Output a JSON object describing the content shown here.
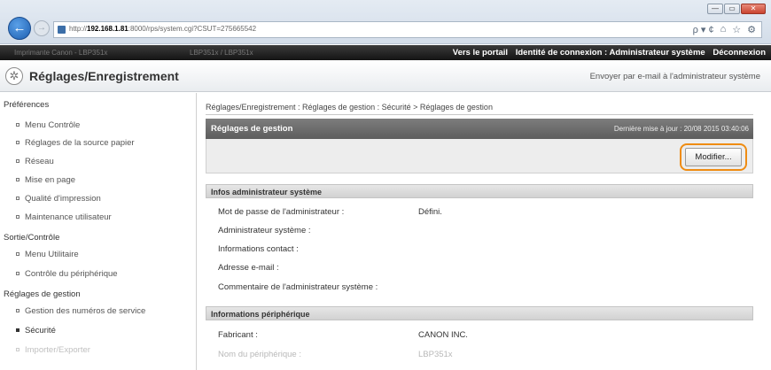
{
  "browser": {
    "url_prefix": "http://",
    "url_host": "192.168.1.81",
    "url_rest": ":8000/rps/system.cgi?CSUT=275665542",
    "search_symbol": "ρ ▾ ¢",
    "window_minimize": "—",
    "window_maximize": "▭",
    "window_close": "✕"
  },
  "topbar": {
    "left_text": "Imprimante Canon - LBP351x",
    "mid_text": "LBP351x / LBP351x",
    "portal_link": "Vers le portail",
    "identity_label": "Identité de connexion : Administrateur système",
    "logout_link": "Déconnexion"
  },
  "header": {
    "title": "Réglages/Enregistrement",
    "email_link": "Envoyer par e-mail à l'administrateur système"
  },
  "sidebar": {
    "sections": [
      {
        "label": "Préférences",
        "items": [
          "Menu Contrôle",
          "Réglages de la source papier",
          "Réseau",
          "Mise en page",
          "Qualité d'impression",
          "Maintenance utilisateur"
        ]
      },
      {
        "label": "Sortie/Contrôle",
        "items": [
          "Menu Utilitaire",
          "Contrôle du périphérique"
        ]
      },
      {
        "label": "Réglages de gestion",
        "items": [
          "Gestion des numéros de service",
          "Sécurité",
          "Importer/Exporter"
        ]
      }
    ]
  },
  "main": {
    "breadcrumb": "Réglages/Enregistrement : Réglages de gestion : Sécurité > Réglages de gestion",
    "panel_title": "Réglages de gestion",
    "last_update": "Dernière mise à jour : 20/08 2015 03:40:06",
    "modify_button": "Modifier...",
    "admin_section": {
      "title": "Infos administrateur système",
      "rows": [
        {
          "label": "Mot de passe de l'administrateur :",
          "value": "Défini."
        },
        {
          "label": "Administrateur système :",
          "value": ""
        },
        {
          "label": "Informations contact :",
          "value": ""
        },
        {
          "label": "Adresse e-mail :",
          "value": ""
        },
        {
          "label": "Commentaire de l'administrateur système :",
          "value": ""
        }
      ]
    },
    "device_section": {
      "title": "Informations périphérique",
      "rows": [
        {
          "label": "Fabricant :",
          "value": "CANON INC."
        },
        {
          "label": "Nom du périphérique :",
          "value": "LBP351x"
        }
      ]
    }
  }
}
